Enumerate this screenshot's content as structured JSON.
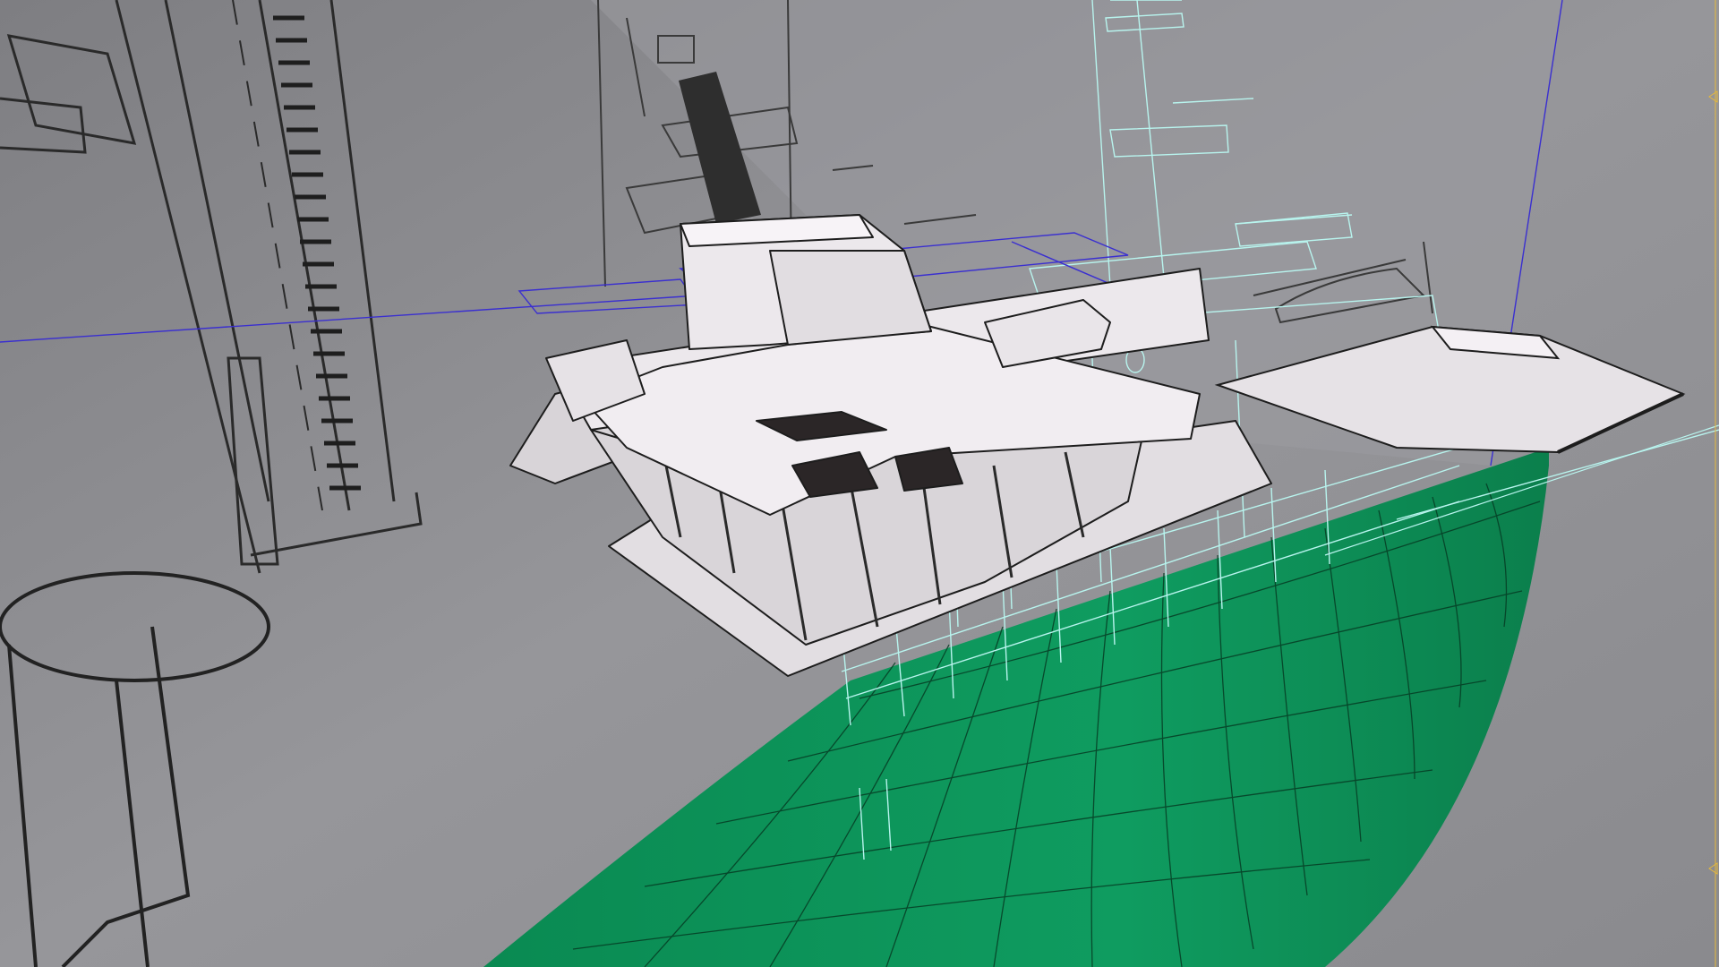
{
  "viewport": {
    "label": "perspective-viewport",
    "background_color": "#8d8d91",
    "hull_color": "#0e9a5e",
    "wire_cyan": "#b8f4ee",
    "wire_blue": "#3a2fd0",
    "accent_yellow": "#e6b93b"
  },
  "blueprint_notes": {
    "note_top": "",
    "note_bottom": "",
    "hull_name": ""
  },
  "icons": {
    "ruler_marker_top": "triangle-marker-icon",
    "ruler_marker_bottom": "triangle-marker-icon"
  }
}
